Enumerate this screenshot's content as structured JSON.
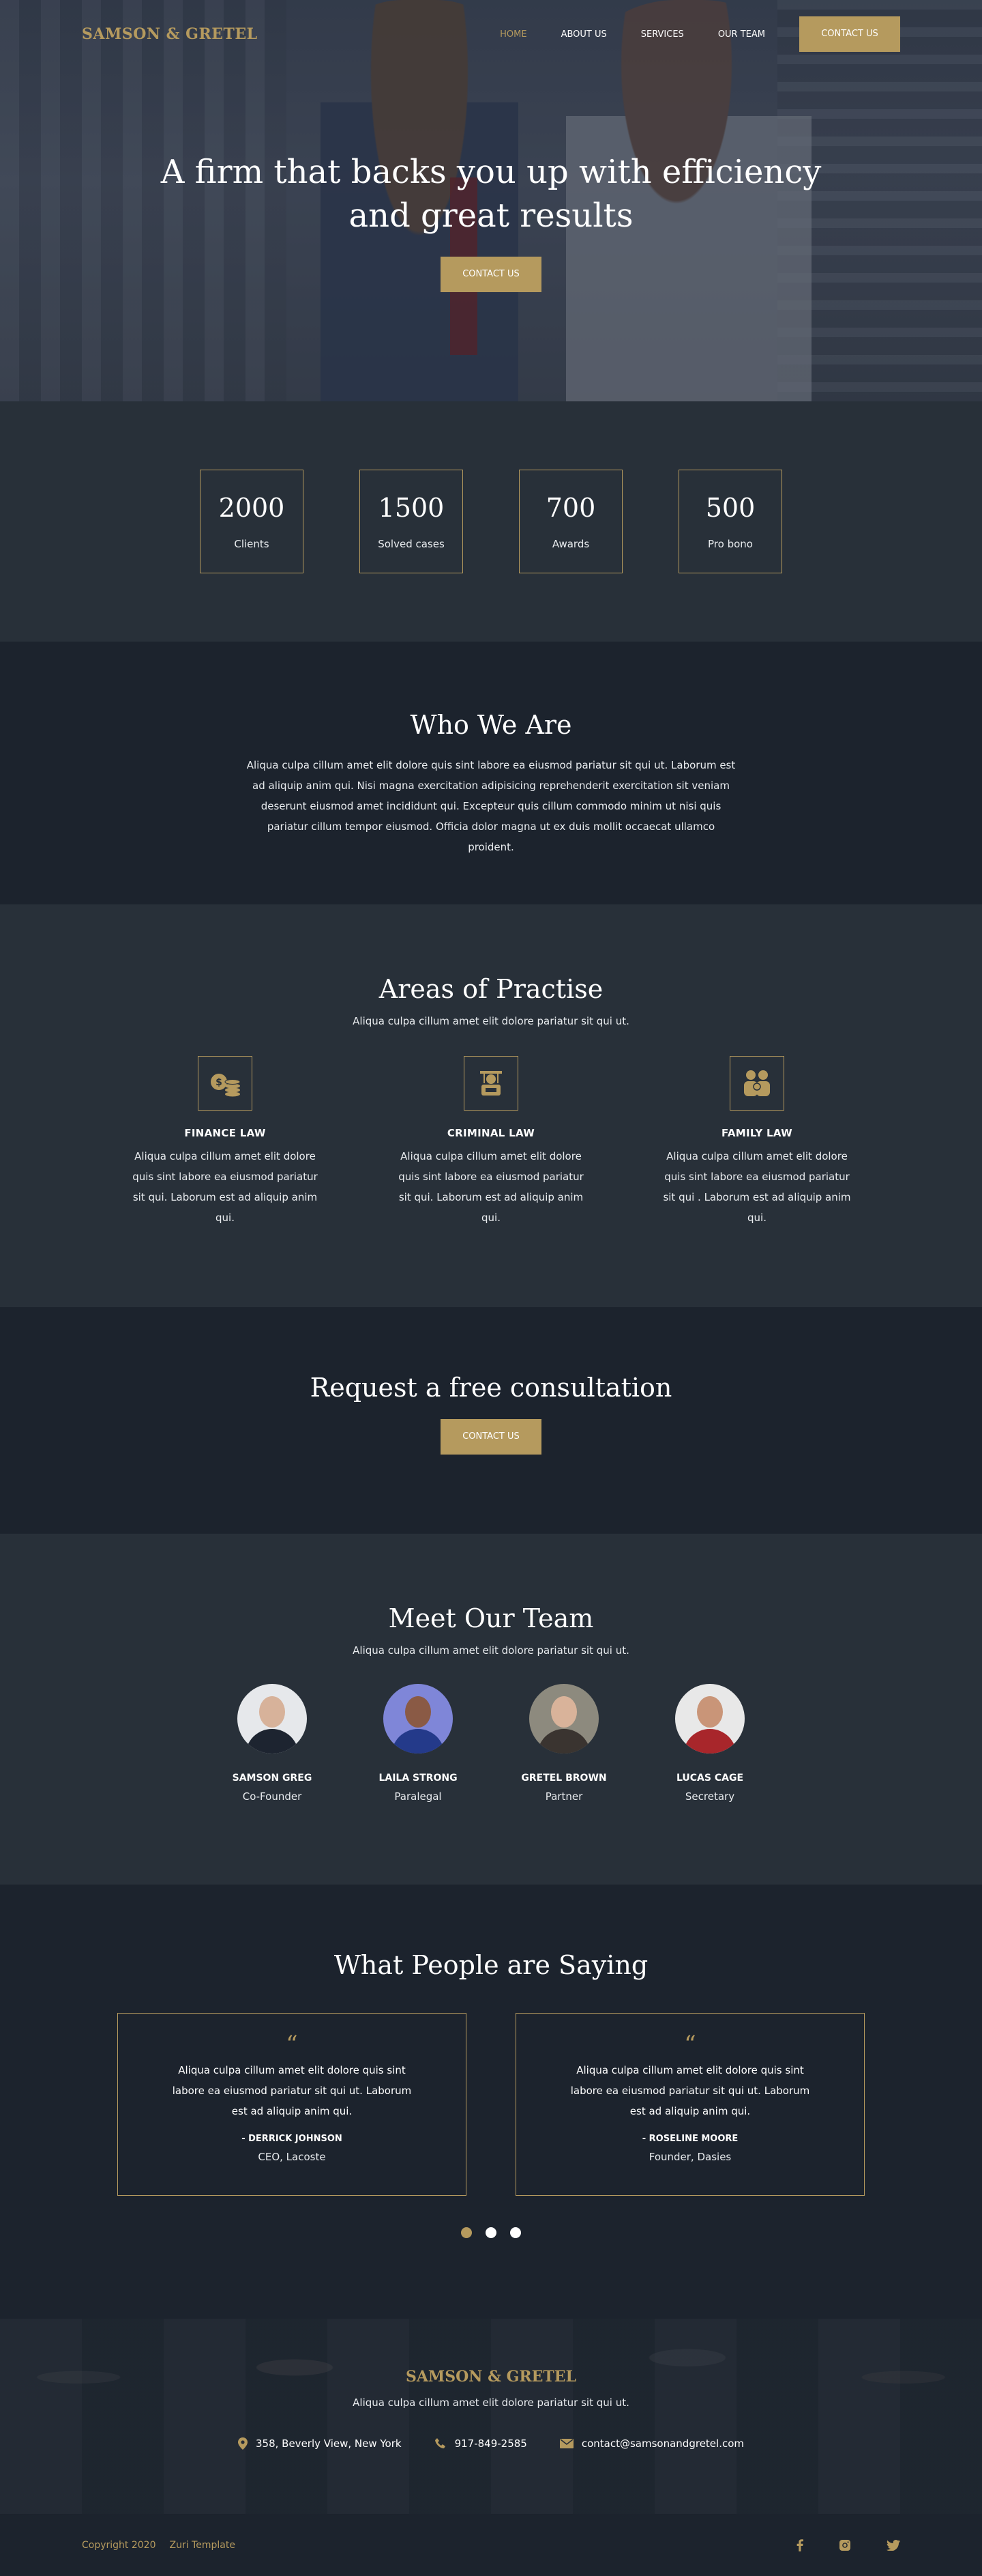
{
  "brand": {
    "logo": "SAMSON & GRETEL",
    "accent": "#b59a5e"
  },
  "nav": {
    "items": [
      {
        "label": "HOME",
        "active": true
      },
      {
        "label": "ABOUT US",
        "active": false
      },
      {
        "label": "SERVICES",
        "active": false
      },
      {
        "label": "OUR TEAM",
        "active": false
      }
    ],
    "cta": "CONTACT US"
  },
  "hero": {
    "title": "A firm that backs you up with efficiency and great results",
    "button": "CONTACT US"
  },
  "stats": [
    {
      "value": "2000",
      "label": "Clients"
    },
    {
      "value": "1500",
      "label": "Solved cases"
    },
    {
      "value": "700",
      "label": "Awards"
    },
    {
      "value": "500",
      "label": "Pro bono"
    }
  ],
  "who": {
    "title": "Who We Are",
    "text": "Aliqua culpa cillum amet elit dolore quis sint labore ea eiusmod pariatur sit qui ut. Laborum est ad aliquip anim qui. Nisi magna exercitation adipisicing reprehenderit exercitation sit veniam deserunt eiusmod amet incididunt qui. Excepteur quis cillum commodo minim ut nisi quis pariatur cillum tempor eiusmod. Officia dolor magna ut ex duis mollit occaecat ullamco proident."
  },
  "areas": {
    "title": "Areas of Practise",
    "subtitle": "Aliqua culpa cillum amet elit dolore pariatur sit qui ut.",
    "items": [
      {
        "icon": "coins-icon",
        "title": "FINANCE LAW",
        "text": "Aliqua culpa cillum amet elit dolore quis sint labore ea eiusmod pariatur sit qui. Laborum est ad aliquip anim qui."
      },
      {
        "icon": "criminal-icon",
        "title": "CRIMINAL LAW",
        "text": "Aliqua culpa cillum amet elit dolore quis sint labore ea eiusmod pariatur sit qui. Laborum est ad aliquip anim qui."
      },
      {
        "icon": "family-icon",
        "title": "FAMILY LAW",
        "text": "Aliqua culpa cillum amet elit dolore quis sint labore ea eiusmod pariatur sit qui . Laborum est ad aliquip anim qui."
      }
    ]
  },
  "consult": {
    "title": "Request a free consultation",
    "button": "CONTACT US"
  },
  "team": {
    "title": "Meet Our Team",
    "subtitle": "Aliqua culpa cillum amet elit dolore pariatur sit qui ut.",
    "members": [
      {
        "name": "SAMSON GREG",
        "role": "Co-Founder"
      },
      {
        "name": "LAILA STRONG",
        "role": "Paralegal"
      },
      {
        "name": "GRETEL BROWN",
        "role": "Partner"
      },
      {
        "name": "LUCAS CAGE",
        "role": "Secretary"
      }
    ]
  },
  "testimonials": {
    "title": "What People are Saying",
    "quote_mark": "“",
    "items": [
      {
        "text": "Aliqua culpa cillum amet elit dolore quis sint labore ea eiusmod pariatur sit qui ut. Laborum est ad aliquip anim qui.",
        "name": "- DERRICK JOHNSON",
        "role": "CEO, Lacoste"
      },
      {
        "text": "Aliqua culpa cillum amet elit dolore quis sint labore ea eiusmod pariatur sit qui ut. Laborum est ad aliquip anim qui.",
        "name": "- ROSELINE MOORE",
        "role": "Founder, Dasies"
      }
    ],
    "active_dot": 1,
    "dot_count": 3
  },
  "footer": {
    "logo": "SAMSON & GRETEL",
    "tagline": "Aliqua culpa cillum amet elit dolore pariatur sit qui ut.",
    "address": "358, Beverly View, New York",
    "phone": "917-849-2585",
    "email": "contact@samsonandgretel.com",
    "copyright": "Copyright 2020",
    "template": "Zuri Template",
    "socials": [
      "facebook-icon",
      "instagram-icon",
      "twitter-icon"
    ]
  }
}
